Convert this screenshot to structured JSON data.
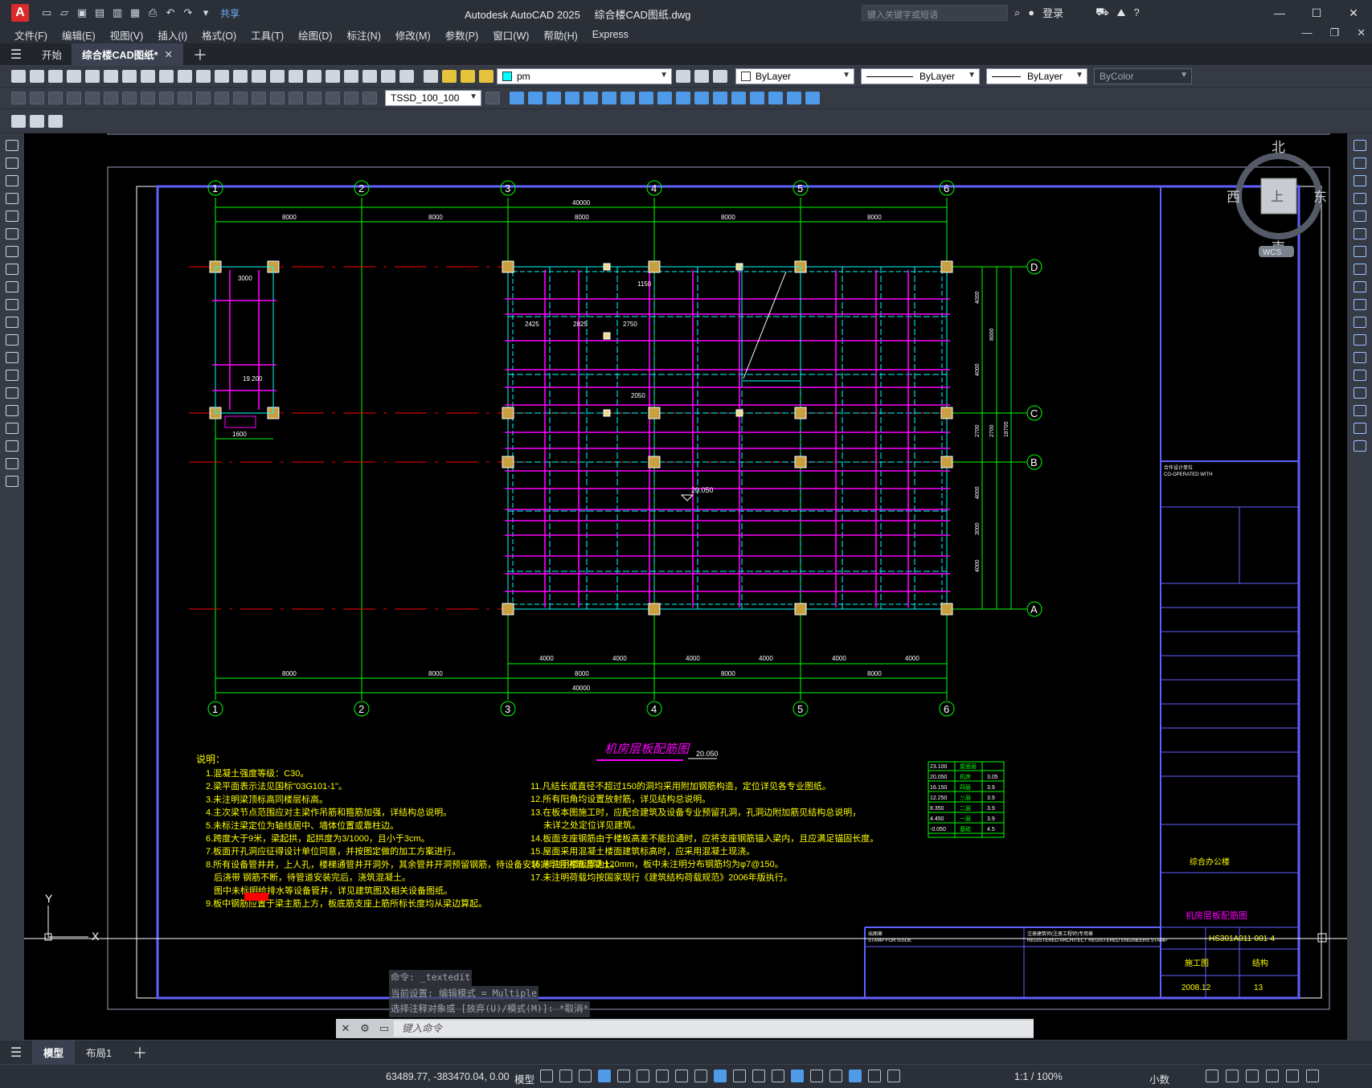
{
  "app": {
    "logo": "A",
    "title": "Autodesk AutoCAD 2025",
    "document": "综合楼CAD图纸.dwg",
    "share": "共享",
    "search_placeholder": "键入关键字或短语",
    "login": "登录"
  },
  "menu": [
    "文件(F)",
    "编辑(E)",
    "视图(V)",
    "插入(I)",
    "格式(O)",
    "工具(T)",
    "绘图(D)",
    "标注(N)",
    "修改(M)",
    "参数(P)",
    "窗口(W)",
    "帮助(H)",
    "Express"
  ],
  "tabs": {
    "start": "开始",
    "active": "综合楼CAD图纸*"
  },
  "properties": {
    "layer": "pm",
    "color": "ByLayer",
    "linetype": "ByLayer",
    "lineweight": "ByLayer",
    "plotstyle": "ByColor",
    "dimstyle": "TSSD_100_100"
  },
  "viewcube": {
    "north": "北",
    "south": "南",
    "east": "东",
    "west": "西",
    "top": "上",
    "wcs": "WCS"
  },
  "drawing": {
    "plan_title": "机房层板配筋图",
    "grid_numbers": [
      "1",
      "2",
      "3",
      "4",
      "5",
      "6"
    ],
    "grid_letters": [
      "D",
      "C",
      "B",
      "A"
    ],
    "overall_dim": "40000",
    "bay_dims": [
      "8000",
      "8000",
      "8000",
      "8000",
      "8000"
    ],
    "bottom_bays": [
      "8000",
      "8000",
      "8000",
      "8000",
      "8000"
    ],
    "half_bays": [
      "4000",
      "4000",
      "4000",
      "4000",
      "4000",
      "4000"
    ],
    "right_dims": [
      "4000",
      "4000",
      "2700",
      "4000",
      "3000",
      "4000"
    ],
    "right_dims_total": [
      "8000",
      "2700",
      "18700"
    ],
    "elev_main": "20.050",
    "elev_small": "19.200",
    "notes_title": "说明：",
    "notes_left": [
      "1.混凝土强度等级：C30。",
      "2.梁平面表示法见国标\"03G101-1\"。",
      "3.未注明梁顶标高同楼层标高。",
      "4.主次梁节点范围应对主梁作吊筋和箍筋加强，详结构总说明。",
      "5.未标注梁定位为轴线居中、墙体位置或靠柱边。",
      "6.跨度大于9米，梁起拱，起拱度为3/1000，且小于3cm。",
      "7.板面开孔洞应征得设计单位同意，并按图定做的加工方案进行。",
      "8.所有设备管井井，上人孔，楼梯通管井开洞外，其余管井开洞预留钢筋，待设备安装完毕后浇筑混凝土。",
      "后浇带        钢筋不断，待管道安装完后，浇筑混凝土。",
      "图中未标明给排水等设备管井，详见建筑图及相关设备图纸。",
      "9.板中钢筋应置于梁主筋上方，板底筋支座上筋所标长度均从梁边算起。"
    ],
    "notes_right": [
      "11.凡结长或直径不超过150的洞均采用附加钢筋构造，定位详见各专业图纸。",
      "12.所有阳角均设置放射筋，详见结构总说明。",
      "13.在板本图施工时，应配合建筑及设备专业预留孔洞，孔洞边附加筋见结构总说明，",
      "未详之处定位详见建筑。",
      "14.板面支座钢筋由于楼板高差不能拉通时，应将支座钢筋锚入梁内，且应满足锚固长度。",
      "15.屋面采用混凝土楼面建筑标高时，应采用混凝土现浇。",
      "16.未注明楼板厚为120mm，板中未注明分布钢筋均为φ7@150。",
      "17.未注明荷载均按国家现行《建筑结构荷载规范》2006年版执行。"
    ],
    "level_table": [
      [
        "23.100",
        "屋面层",
        ""
      ],
      [
        "20.050",
        "机房",
        "3.05"
      ],
      [
        "16.150",
        "四层",
        "3.9"
      ],
      [
        "12.250",
        "三层",
        "3.9"
      ],
      [
        "8.350",
        "二层",
        "3.9"
      ],
      [
        "4.450",
        "一层",
        "3.9"
      ],
      [
        "-0.050",
        "基础",
        "4.5"
      ]
    ],
    "titleblock": {
      "coop": "合作设计单位",
      "coop_en": "CO-OPERATED WITH",
      "stamp": "出图章",
      "stamp_en": "STAMP FOR ISSUE",
      "reg": "注册建筑师(注册工程师)专用章",
      "reg_en": "REGISTERED ARCHITECT REGISTERED ENGINEERS STAMP",
      "project": "综合办公楼",
      "drawing": "机房层板配筋图",
      "job_no": "HS301A011-001-4",
      "status": "施工图",
      "discipline": "结构",
      "date": "2008.12",
      "sheet": "13"
    },
    "ucs_y": "Y",
    "ucs_x": "X"
  },
  "command": {
    "history": [
      "命令: _textedit",
      "当前设置: 编辑模式 = Multiple",
      "选择注释对象或 [放弃(U)/模式(M)]: *取消*"
    ],
    "placeholder": "键入命令"
  },
  "layouts": {
    "model": "模型",
    "layout1": "布局1"
  },
  "status": {
    "coords": "63489.77, -383470.04, 0.00",
    "model": "模型",
    "scale": "1:1 / 100%",
    "units": "小数"
  }
}
